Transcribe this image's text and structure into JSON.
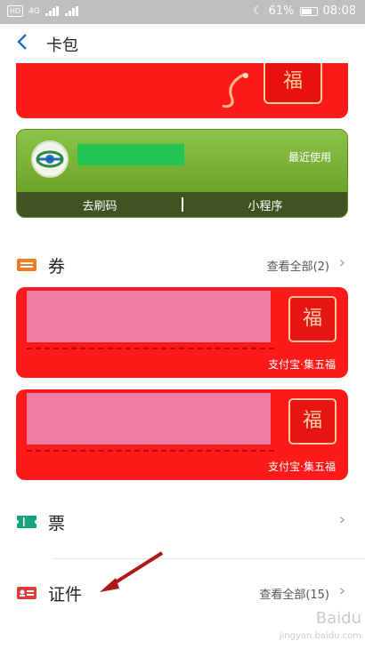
{
  "status_bar": {
    "hd": "HD",
    "network": "4G",
    "battery": "61%",
    "time": "08:08"
  },
  "header": {
    "back_icon": "chevron-left-icon",
    "title": "卡包"
  },
  "top_card": {
    "fu_char": "福"
  },
  "green_card": {
    "recent": "最近使用",
    "btn_code": "去刷码",
    "btn_mini": "小程序"
  },
  "coupons_section": {
    "title": "券",
    "link": "查看全部(2)",
    "icon": "ticket-icon",
    "cards": [
      {
        "fu_char": "福",
        "source": "支付宝·集五福"
      },
      {
        "fu_char": "福",
        "source": "支付宝·集五福"
      }
    ]
  },
  "tickets_section": {
    "title": "票",
    "icon": "ticket-stub-icon"
  },
  "docs_section": {
    "title": "证件",
    "link": "查看全部(15)",
    "icon": "id-card-icon"
  },
  "watermark": {
    "brand": "Baidu",
    "sub": "jingyan.baidu.com"
  },
  "colors": {
    "red": "#ff1a1a",
    "green": "#8bc34a",
    "accent_blue": "#1a73c8"
  }
}
